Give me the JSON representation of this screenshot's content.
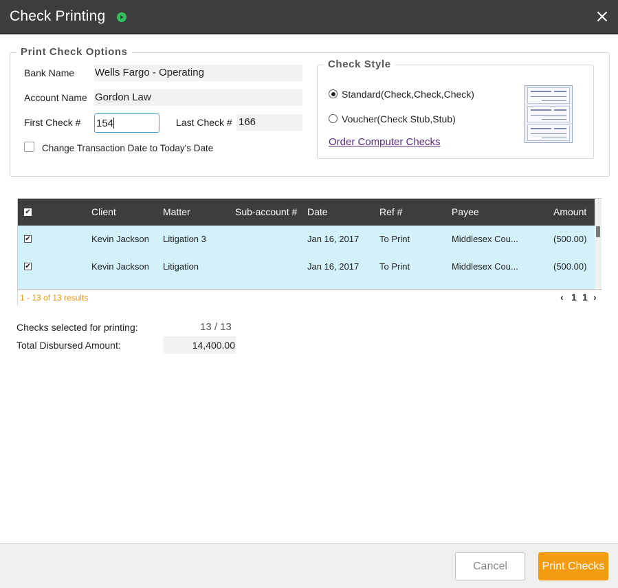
{
  "header": {
    "title": "Check Printing"
  },
  "options": {
    "legend": "Print Check Options",
    "bank_name_label": "Bank Name",
    "bank_name_value": "Wells Fargo - Operating",
    "account_name_label": "Account Name",
    "account_name_value": "Gordon Law",
    "first_check_label": "First Check #",
    "first_check_value": "154",
    "last_check_label": "Last Check #",
    "last_check_value": "166",
    "change_date_label": "Change Transaction Date to Today's Date"
  },
  "check_style": {
    "legend": "Check Style",
    "standard_label": "Standard(Check,Check,Check)",
    "voucher_label": "Voucher(Check Stub,Stub)",
    "selected": "standard",
    "order_link": "Order Computer Checks"
  },
  "grid": {
    "columns": [
      "Client",
      "Matter",
      "Sub-account #",
      "Date",
      "Ref #",
      "Payee",
      "Amount"
    ],
    "rows": [
      {
        "client": "Kevin Jackson",
        "matter": "Litigation 3",
        "subaccount": "",
        "date": "Jan 16, 2017",
        "ref": "To Print",
        "payee": "Middlesex Cou...",
        "amount": "(500.00)",
        "checked": true
      },
      {
        "client": "Kevin Jackson",
        "matter": "Litigation",
        "subaccount": "",
        "date": "Jan 16, 2017",
        "ref": "To Print",
        "payee": "Middlesex Cou...",
        "amount": "(500.00)",
        "checked": true
      }
    ],
    "results_text": "1 - 13 of 13 results",
    "pager": {
      "prev": "‹",
      "current_page": "1",
      "total_pages": "1",
      "next": "›"
    }
  },
  "summary": {
    "checks_selected_label": "Checks selected for printing:",
    "checks_selected_value": "13 / 13",
    "total_label": "Total Disbursed Amount:",
    "total_value": "14,400.00"
  },
  "footer": {
    "cancel_label": "Cancel",
    "print_label": "Print Checks"
  },
  "colors": {
    "header_bg": "#3d3d3d",
    "row_highlight": "#d2f1f9",
    "accent": "#f39c12",
    "results_text": "#f0941b",
    "play_icon": "#2fc15b",
    "link": "#5a2d82"
  }
}
